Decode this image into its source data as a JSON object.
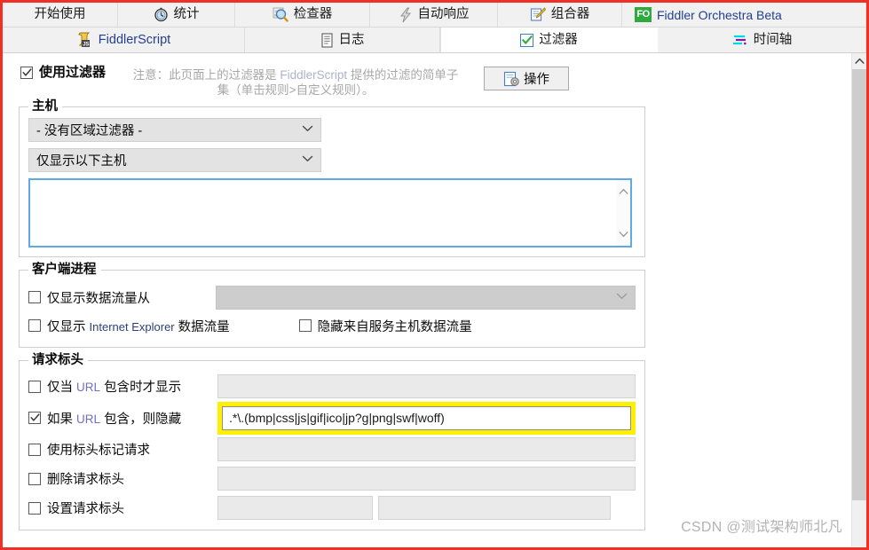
{
  "window": {
    "accent_border": "#ee3124",
    "active_tab": "过滤器"
  },
  "tabs_row1": [
    {
      "label": "开始使用",
      "icon": "none",
      "active": false
    },
    {
      "label": "统计",
      "icon": "clock-icon",
      "active": false
    },
    {
      "label": "检查器",
      "icon": "magnifier-icon",
      "active": false
    },
    {
      "label": "自动响应",
      "icon": "lightning-icon",
      "active": false
    },
    {
      "label": "组合器",
      "icon": "pencil-note-icon",
      "active": false
    },
    {
      "label": "Fiddler Orchestra Beta",
      "icon": "fo-badge-icon",
      "active": false
    }
  ],
  "tabs_row2": [
    {
      "label": "FiddlerScript",
      "icon": "js-scroll-icon",
      "active": false
    },
    {
      "label": "日志",
      "icon": "log-page-icon",
      "active": false
    },
    {
      "label": "过滤器",
      "icon": "checkbox-green-icon",
      "active": true
    },
    {
      "label": "时间轴",
      "icon": "timeline-icon",
      "active": false
    }
  ],
  "toolbar": {
    "use_filters_label": "使用过滤器",
    "use_filters_checked": true,
    "note_line1_prefix": "注意：",
    "note_line1_a": "此页面上的过滤器是 ",
    "note_fiddlerscript": "FiddlerScript",
    "note_line1_b": " 提供的过滤的简单子",
    "note_line2": "集（单击规则>自定义规则）。",
    "actions_label": "操作"
  },
  "hosts": {
    "legend": "主机",
    "zone_filter_value": "- 没有区域过滤器 -",
    "show_only_value": "仅显示以下主机",
    "hosts_textarea_value": "",
    "hosts_textarea_placeholder": ""
  },
  "client_process": {
    "legend": "客户端进程",
    "show_traffic_from_label": "仅显示数据流量从",
    "show_traffic_from_checked": false,
    "process_select_value": "",
    "show_ie_label_a": "仅显示 ",
    "show_ie_label_browser": "Internet Explorer",
    "show_ie_label_b": " 数据流量",
    "show_ie_checked": false,
    "hide_svchost_label": "隐藏来自服务主机数据流量",
    "hide_svchost_checked": false
  },
  "request_headers": {
    "legend": "请求标头",
    "rows": [
      {
        "label_a": "仅当 ",
        "label_url": "URL",
        "label_b": " 包含时才显示",
        "checked": false,
        "value": "",
        "highlighted": false,
        "enabled": false
      },
      {
        "label_a": "如果 ",
        "label_url": "URL",
        "label_b": " 包含，则隐藏",
        "checked": true,
        "value": ".*\\.(bmp|css|js|gif|ico|jp?g|png|swf|woff)",
        "highlighted": true,
        "enabled": true
      },
      {
        "label_a": "",
        "label_url": "",
        "label_b": "使用标头标记请求",
        "checked": false,
        "value": "",
        "highlighted": false,
        "enabled": false
      },
      {
        "label_a": "",
        "label_url": "",
        "label_b": "删除请求标头",
        "checked": false,
        "value": "",
        "highlighted": false,
        "enabled": false
      },
      {
        "label_a": "",
        "label_url": "",
        "label_b": "设置请求标头",
        "checked": false,
        "value": "",
        "value2": "",
        "highlighted": false,
        "enabled": false,
        "split": true
      }
    ]
  },
  "scrollbar": {
    "up_arrow": "▲"
  },
  "watermark": {
    "text": "CSDN @测试架构师北凡"
  },
  "colors": {
    "highlight": "#ffef00",
    "border_red": "#ee3124",
    "focus_blue": "#5ea9e8",
    "link_blue": "#243f8f",
    "fo_green": "#2faa3f"
  }
}
